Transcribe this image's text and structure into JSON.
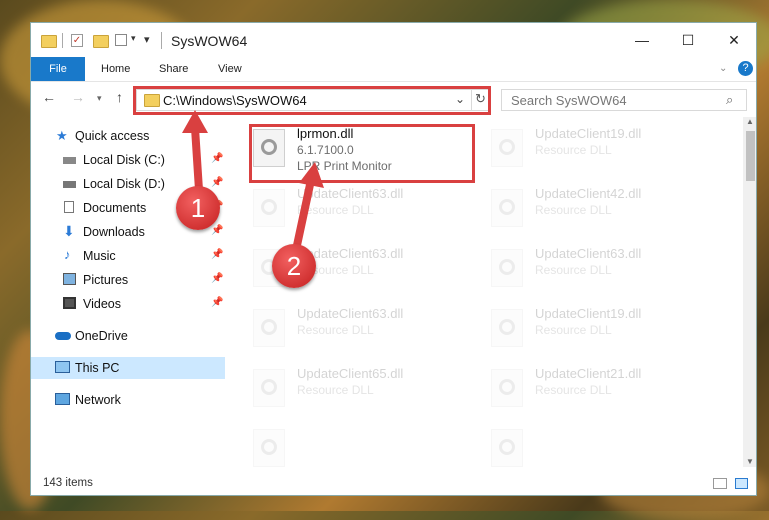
{
  "window": {
    "title": "SysWOW64",
    "minimize": "—",
    "maximize": "☐",
    "close": "✕"
  },
  "ribbon": {
    "file": "File",
    "home": "Home",
    "share": "Share",
    "view": "View",
    "help": "?"
  },
  "address": {
    "path": "C:\\Windows\\SysWOW64",
    "search_placeholder": "Search SysWOW64"
  },
  "sidebar": {
    "items": [
      {
        "label": "Quick access"
      },
      {
        "label": "Local Disk (C:)"
      },
      {
        "label": "Local Disk (D:)"
      },
      {
        "label": "Documents"
      },
      {
        "label": "Downloads"
      },
      {
        "label": "Music"
      },
      {
        "label": "Pictures"
      },
      {
        "label": "Videos"
      },
      {
        "label": "OneDrive"
      },
      {
        "label": "This PC"
      },
      {
        "label": "Network"
      }
    ]
  },
  "files": [
    {
      "name": "lprmon.dll",
      "version": "6.1.7100.0",
      "desc": "LPR Print Monitor"
    },
    {
      "name": "UpdateClient19.dll",
      "desc": "Resource DLL"
    },
    {
      "name": "UpdateClient63.dll",
      "desc": "Resource DLL"
    },
    {
      "name": "UpdateClient42.dll",
      "desc": "Resource DLL"
    },
    {
      "name": "UpdateClient63.dll",
      "desc": "Resource DLL"
    },
    {
      "name": "UpdateClient63.dll",
      "desc": "Resource DLL"
    },
    {
      "name": "UpdateClient63.dll",
      "desc": "Resource DLL"
    },
    {
      "name": "UpdateClient19.dll",
      "desc": "Resource DLL"
    },
    {
      "name": "UpdateClient65.dll",
      "desc": "Resource DLL"
    },
    {
      "name": "UpdateClient21.dll",
      "desc": "Resource DLL"
    }
  ],
  "status": {
    "count": "143 items"
  },
  "annotations": {
    "step1": "1",
    "step2": "2"
  },
  "colors": {
    "accent": "#1979ca",
    "highlight": "#d94040"
  }
}
